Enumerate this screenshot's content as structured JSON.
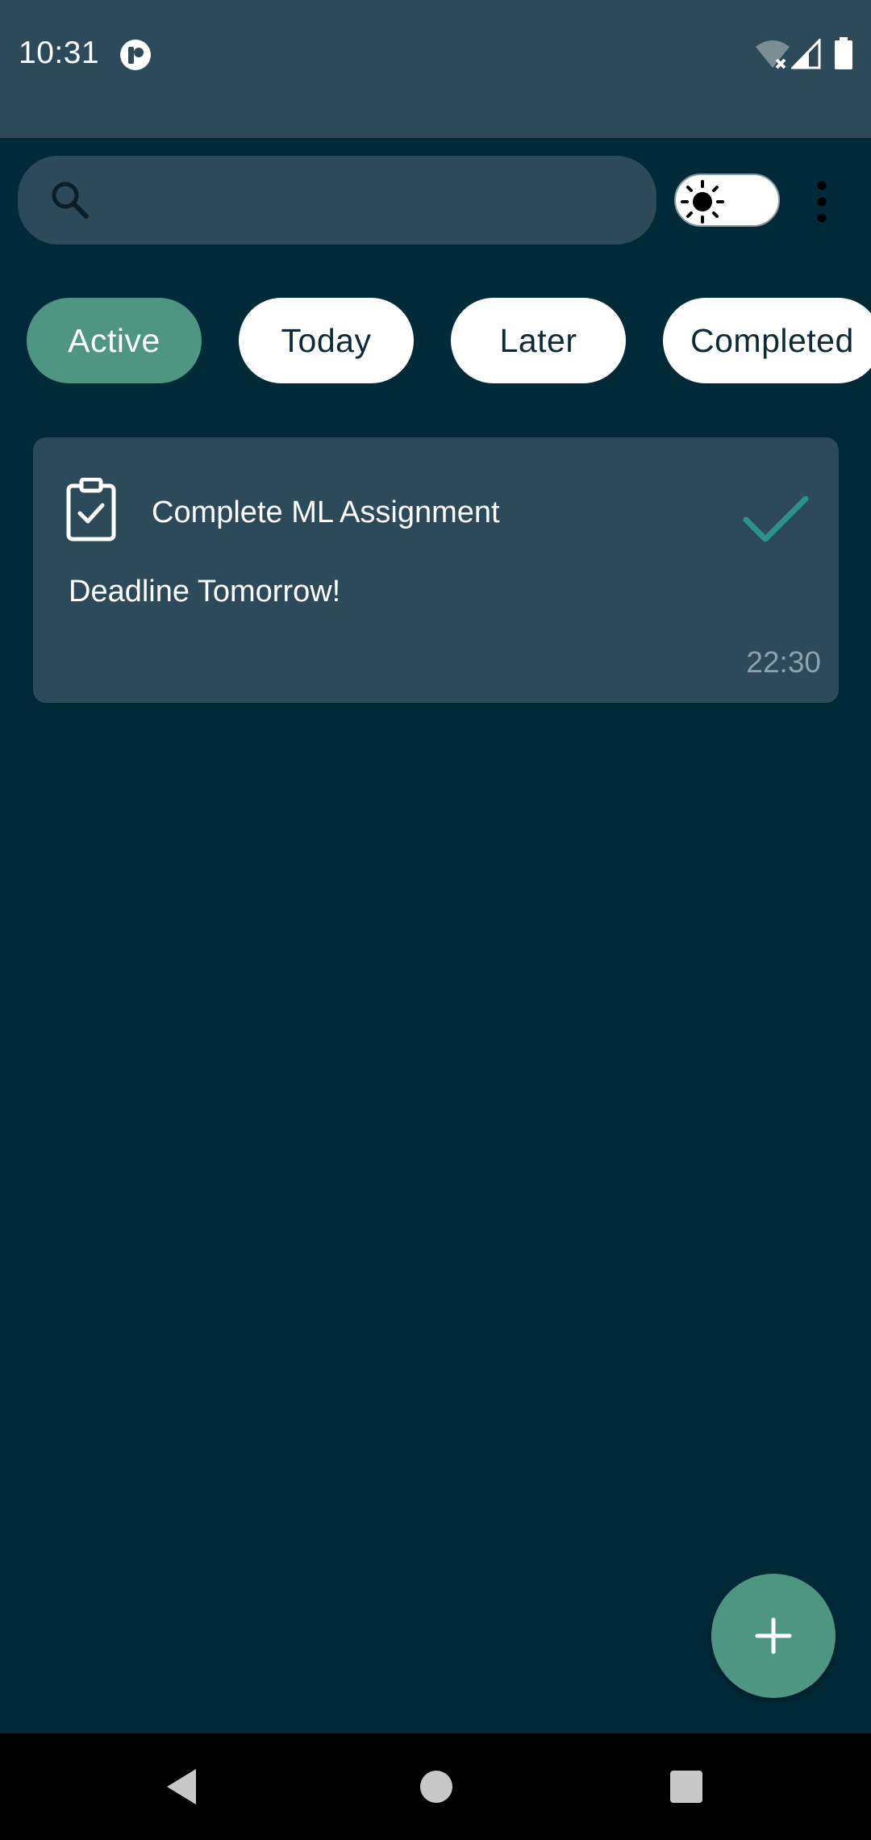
{
  "status_bar": {
    "time": "10:31",
    "icons": [
      "app-notification-icon",
      "wifi-off-icon",
      "signal-icon",
      "battery-icon"
    ]
  },
  "toolbar": {
    "search": {
      "placeholder": "",
      "value": ""
    },
    "theme_toggle": {
      "mode": "light",
      "icon": "sun-icon"
    },
    "menu_icon": "more-vert-icon"
  },
  "filters": {
    "chips": [
      {
        "label": "Active",
        "selected": true
      },
      {
        "label": "Today",
        "selected": false
      },
      {
        "label": "Later",
        "selected": false
      },
      {
        "label": "Completed",
        "selected": false
      }
    ]
  },
  "tasks": [
    {
      "title": "Complete ML Assignment",
      "description": "Deadline Tomorrow!",
      "time": "22:30",
      "icon": "clipboard-check-icon",
      "action_icon": "check-icon"
    }
  ],
  "fab": {
    "icon": "plus-icon"
  },
  "colors": {
    "background": "#012a38",
    "surface": "#2c4a5a",
    "accent": "#4e9582",
    "check": "#2a9488",
    "chip": "#ffffff",
    "muted_text": "#8ea2ad"
  }
}
